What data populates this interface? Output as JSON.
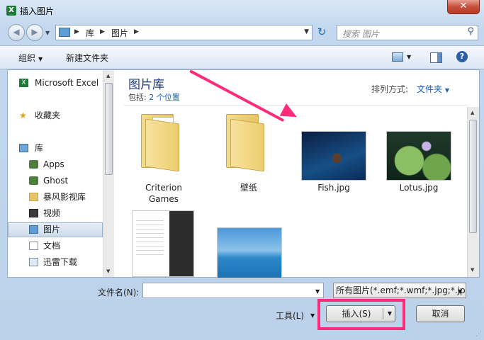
{
  "window": {
    "title": "插入图片",
    "app_icon": "excel-icon",
    "close_label": "✕"
  },
  "address": {
    "segments": [
      "库",
      "图片"
    ]
  },
  "search": {
    "placeholder": "搜索 图片"
  },
  "toolbar": {
    "organize": "组织",
    "new_folder": "新建文件夹"
  },
  "sidebar": {
    "items": [
      {
        "label": "Microsoft Excel",
        "icon": "excel-icon"
      },
      {
        "label": "收藏夹",
        "icon": "star-icon"
      },
      {
        "label": "库",
        "icon": "library-icon"
      },
      {
        "label": "Apps",
        "icon": "apps-icon"
      },
      {
        "label": "Ghost",
        "icon": "ghost-icon"
      },
      {
        "label": "暴风影视库",
        "icon": "folder-icon"
      },
      {
        "label": "视频",
        "icon": "video-icon"
      },
      {
        "label": "图片",
        "icon": "pictures-icon",
        "selected": true
      },
      {
        "label": "文档",
        "icon": "document-icon"
      },
      {
        "label": "迅雷下载",
        "icon": "download-icon"
      }
    ]
  },
  "library": {
    "title": "图片库",
    "includes_prefix": "包括: ",
    "includes_link": "2 个位置",
    "sort_label": "排列方式:",
    "sort_value": "文件夹"
  },
  "files": [
    {
      "name": "Criterion\nGames",
      "kind": "folder"
    },
    {
      "name": "壁纸",
      "kind": "folder"
    },
    {
      "name": "Fish.jpg",
      "kind": "image"
    },
    {
      "name": "Lotus.jpg",
      "kind": "image"
    },
    {
      "name": "",
      "kind": "image"
    },
    {
      "name": "",
      "kind": "image"
    }
  ],
  "footer": {
    "filename_label": "文件名(N):",
    "filename_value": "",
    "filter_value": "所有图片(*.emf;*.wmf;*.jpg;*.jpeg;*.png)",
    "tools_label": "工具(L)",
    "insert_label": "插入(S)",
    "cancel_label": "取消"
  },
  "colors": {
    "highlight": "#ff2a7a",
    "link": "#1a5fb4"
  }
}
